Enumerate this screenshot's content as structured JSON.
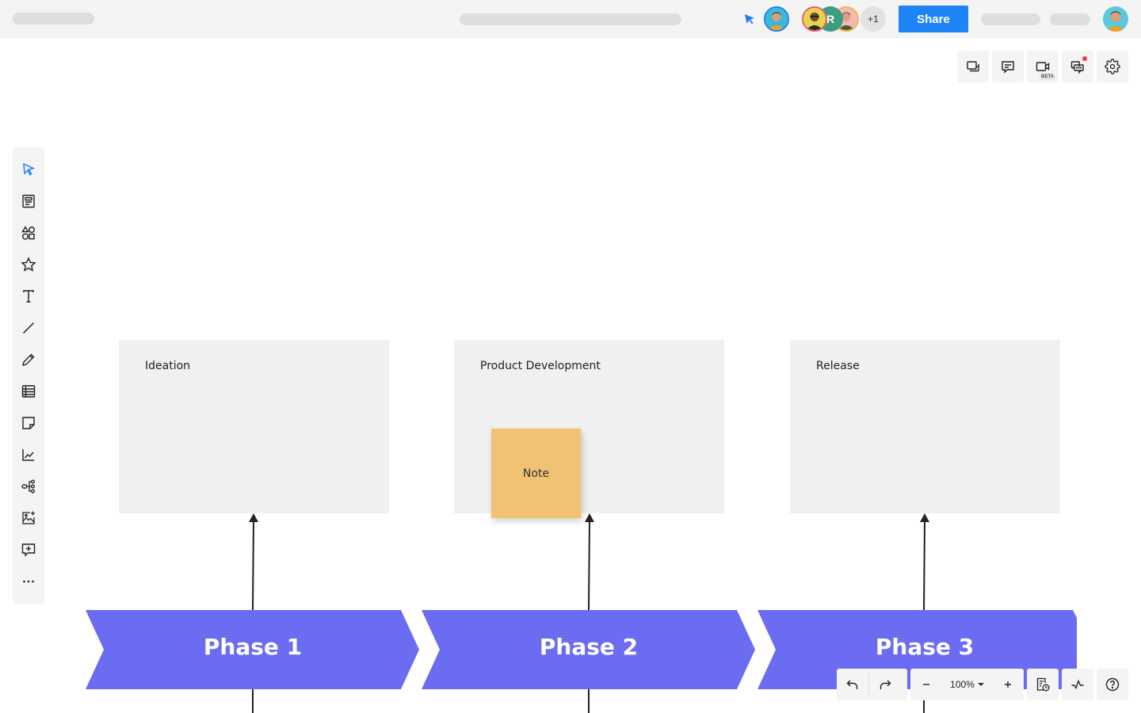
{
  "topbar": {
    "share_label": "Share",
    "collaborators_overflow": "+1",
    "collaborator_initial": "R"
  },
  "right_tools": [
    {
      "name": "pages-icon"
    },
    {
      "name": "comments-icon"
    },
    {
      "name": "video-icon",
      "badge": "BETA"
    },
    {
      "name": "chat-icon",
      "notification": true
    },
    {
      "name": "settings-icon"
    }
  ],
  "left_toolbar": [
    {
      "name": "select-tool"
    },
    {
      "name": "template-tool"
    },
    {
      "name": "shapes-tool"
    },
    {
      "name": "icons-tool"
    },
    {
      "name": "text-tool"
    },
    {
      "name": "line-tool"
    },
    {
      "name": "pen-tool"
    },
    {
      "name": "table-tool"
    },
    {
      "name": "sticky-note-tool"
    },
    {
      "name": "chart-tool"
    },
    {
      "name": "mind-map-tool"
    },
    {
      "name": "image-upload-tool"
    },
    {
      "name": "add-comment-tool"
    },
    {
      "name": "more-tools"
    }
  ],
  "canvas": {
    "cards": [
      {
        "title": "Ideation"
      },
      {
        "title": "Product Development"
      },
      {
        "title": "Release"
      }
    ],
    "sticky_note": {
      "text": "Note",
      "color": "#f1c174"
    },
    "phases": [
      {
        "label": "Phase 1"
      },
      {
        "label": "Phase 2"
      },
      {
        "label": "Phase 3"
      }
    ],
    "phase_color": "#6b6cf2"
  },
  "bottom_bar": {
    "zoom_level": "100%"
  },
  "colors": {
    "accent": "#1f84f5",
    "toolbar_bg": "#f4f4f4",
    "card_bg": "#f0f0f0"
  }
}
